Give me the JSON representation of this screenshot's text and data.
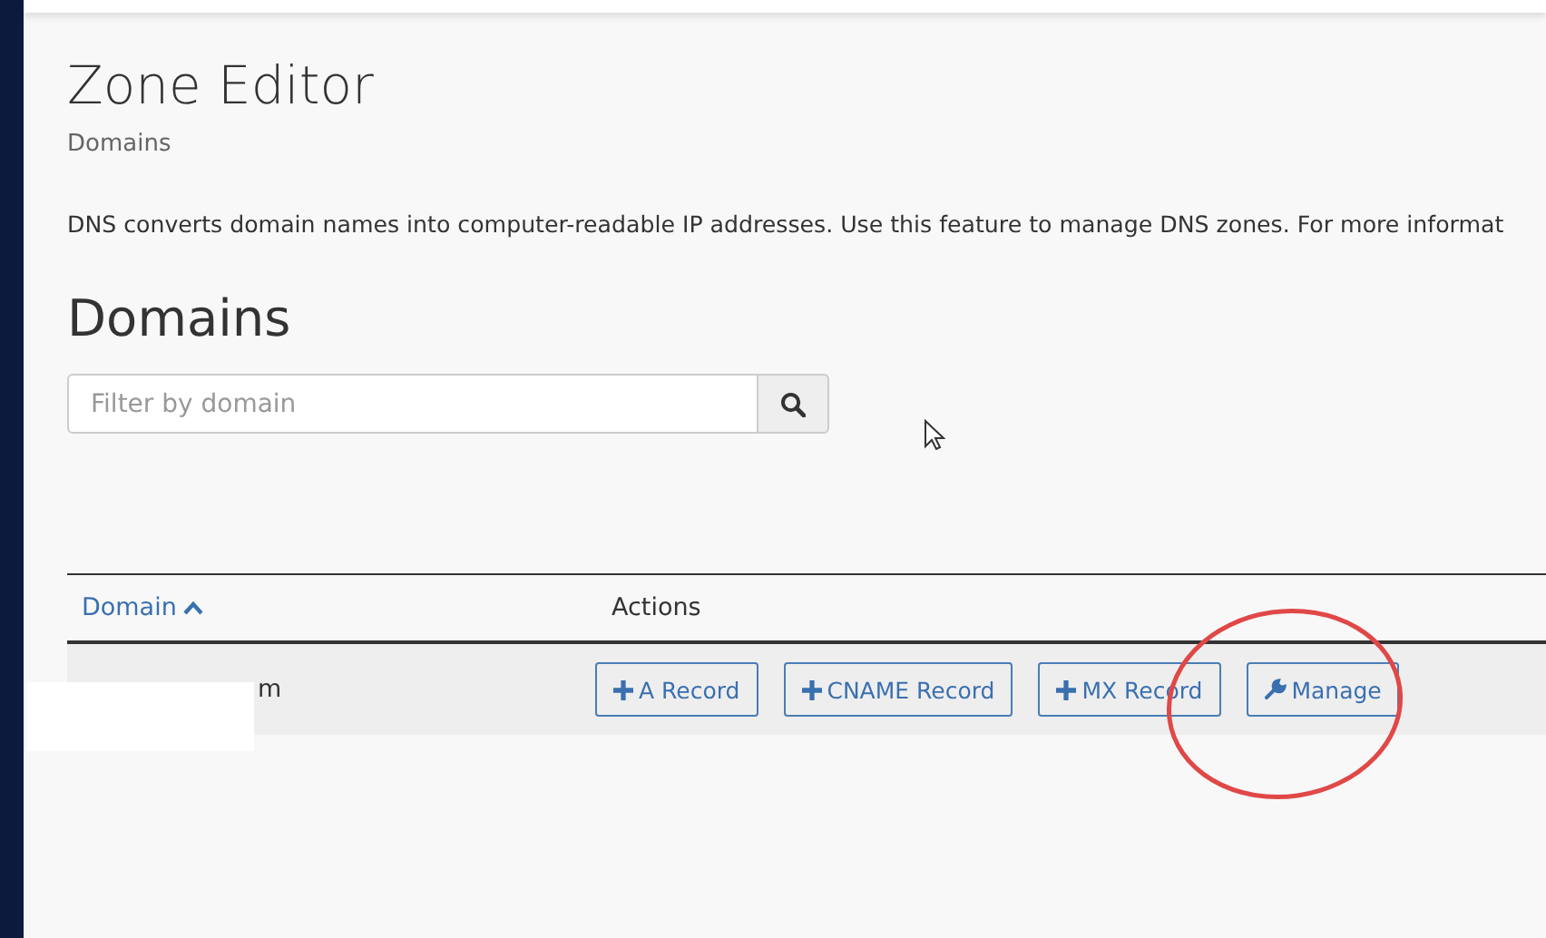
{
  "page": {
    "title": "Zone Editor",
    "breadcrumb": "Domains",
    "description": "DNS converts domain names into computer-readable IP addresses. Use this feature to manage DNS zones. For more informat"
  },
  "section": {
    "title": "Domains",
    "search": {
      "placeholder": "Filter by domain"
    }
  },
  "table": {
    "columns": [
      {
        "label": "Domain",
        "sorted": true
      },
      {
        "label": "Actions",
        "sorted": false
      }
    ],
    "rows": [
      {
        "domain": "m",
        "actions": [
          {
            "label": "A Record",
            "kind": "add"
          },
          {
            "label": "CNAME Record",
            "kind": "add"
          },
          {
            "label": "MX Record",
            "kind": "add"
          },
          {
            "label": "Manage",
            "kind": "manage"
          }
        ]
      }
    ]
  }
}
